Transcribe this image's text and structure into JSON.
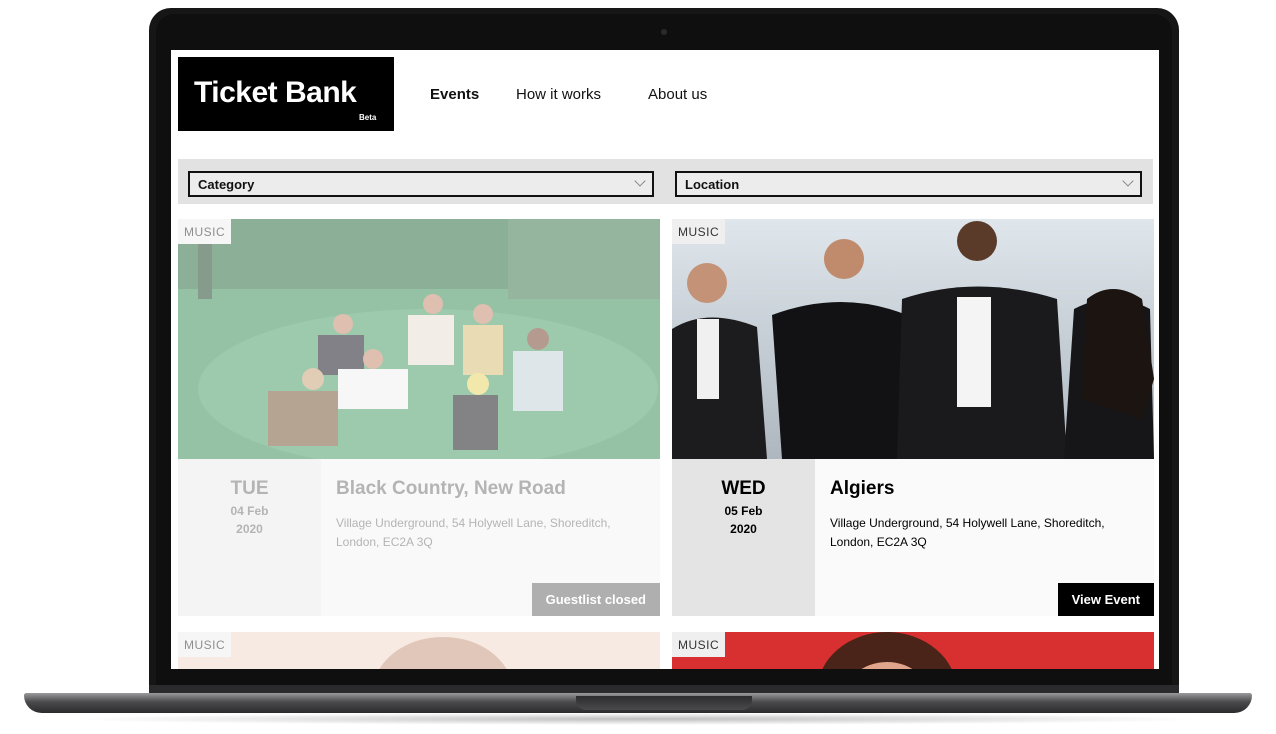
{
  "brand": {
    "name": "Ticket Bank",
    "badge": "Beta"
  },
  "nav": [
    {
      "label": "Events",
      "active": true
    },
    {
      "label": "How it works",
      "active": false
    },
    {
      "label": "About us",
      "active": false
    }
  ],
  "filters": {
    "category": {
      "value": "Category"
    },
    "location": {
      "value": "Location"
    }
  },
  "events": [
    {
      "tag": "MUSIC",
      "day": "TUE",
      "date": "04 Feb",
      "year": "2020",
      "title": "Black Country, New Road",
      "venue": "Village Underground, 54 Holywell Lane, Shoreditch, London, EC2A 3Q",
      "action": "Guestlist closed",
      "status": "closed"
    },
    {
      "tag": "MUSIC",
      "day": "WED",
      "date": "05 Feb",
      "year": "2020",
      "title": "Algiers",
      "venue": "Village Underground, 54 Holywell Lane, Shoreditch, London, EC2A 3Q",
      "action": "View Event",
      "status": "open"
    },
    {
      "tag": "MUSIC"
    },
    {
      "tag": "MUSIC"
    }
  ],
  "colors": {
    "brand_bg": "#000000",
    "closed_button": "#9a9a9a",
    "view_button": "#000000",
    "filter_bar": "#e2e2e2",
    "accent_red": "#e03a3a"
  }
}
